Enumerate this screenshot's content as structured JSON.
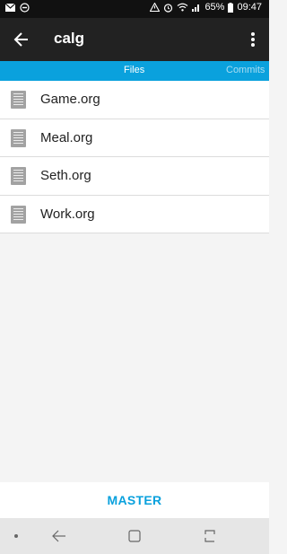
{
  "status_bar": {
    "battery": "65%",
    "time": "09:47",
    "icons_left": [
      "mail-icon",
      "minus-circle-icon"
    ],
    "icons_right": [
      "warning-icon",
      "alarm-icon",
      "wifi-icon",
      "signal-icon",
      "battery-icon"
    ]
  },
  "app_bar": {
    "title": "calg",
    "back_icon": "arrow-left-icon",
    "overflow_icon": "more-vert-icon"
  },
  "tabs": [
    {
      "label": "Files",
      "selected": true
    },
    {
      "label": "Commits",
      "selected": false
    }
  ],
  "files": [
    {
      "name": "Game.org",
      "icon": "document-icon"
    },
    {
      "name": "Meal.org",
      "icon": "document-icon"
    },
    {
      "name": "Seth.org",
      "icon": "document-icon"
    },
    {
      "name": "Work.org",
      "icon": "document-icon"
    }
  ],
  "branch_button": {
    "label": "MASTER"
  },
  "colors": {
    "accent": "#0aa1dd",
    "app_bar": "#222222",
    "status_bar": "#111111"
  }
}
